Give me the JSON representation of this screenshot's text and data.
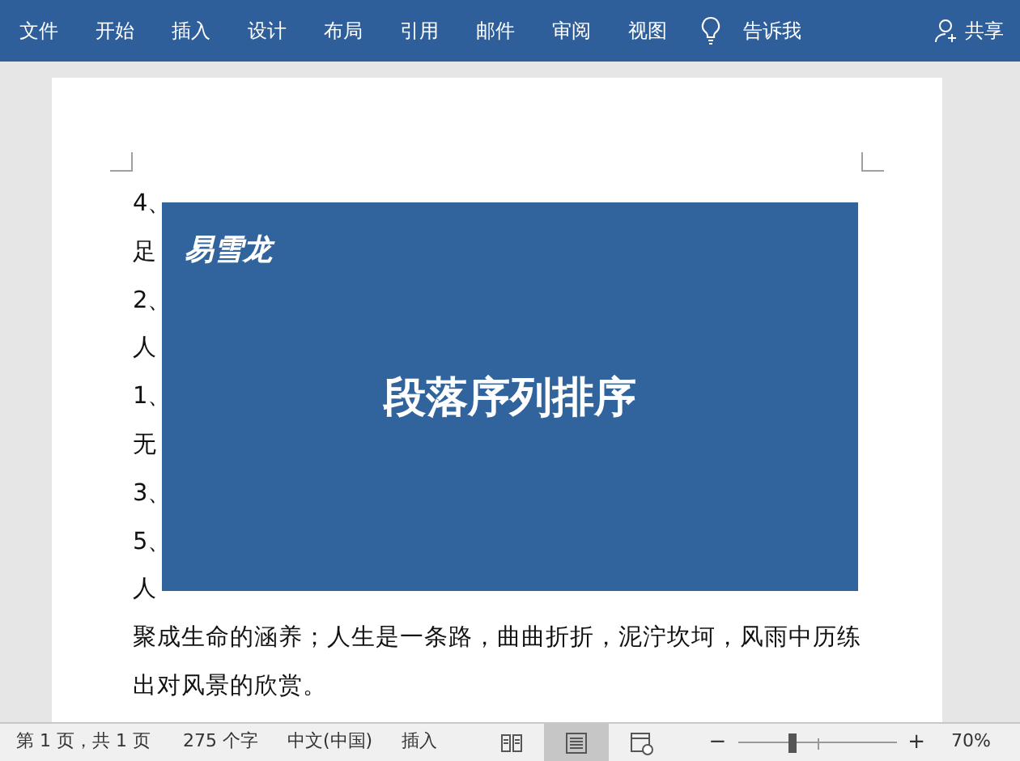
{
  "ribbon": {
    "tabs": [
      "文件",
      "开始",
      "插入",
      "设计",
      "布局",
      "引用",
      "邮件",
      "审阅",
      "视图"
    ],
    "tell_me": "告诉我",
    "share": "共享"
  },
  "document": {
    "lines": [
      "4、",
      "足",
      "2、",
      "人",
      "1、",
      "无",
      "3、",
      "5、",
      "人",
      "聚成生命的涵养；人生是一条路，曲曲折折，泥泞坎坷，风雨中历练",
      "出对风景的欣赏。"
    ]
  },
  "overlay": {
    "logo": "易雪龙",
    "title": "段落序列排序"
  },
  "status_bar": {
    "page": "第 1 页，共 1 页",
    "words": "275 个字",
    "language": "中文(中国)",
    "mode": "插入",
    "views": [
      {
        "kind": "read",
        "selected": false
      },
      {
        "kind": "print",
        "selected": true
      },
      {
        "kind": "web",
        "selected": false
      }
    ],
    "zoom_out": "−",
    "zoom_in": "+",
    "zoom": {
      "level": 0.34
    },
    "zoom_value": "70%"
  }
}
